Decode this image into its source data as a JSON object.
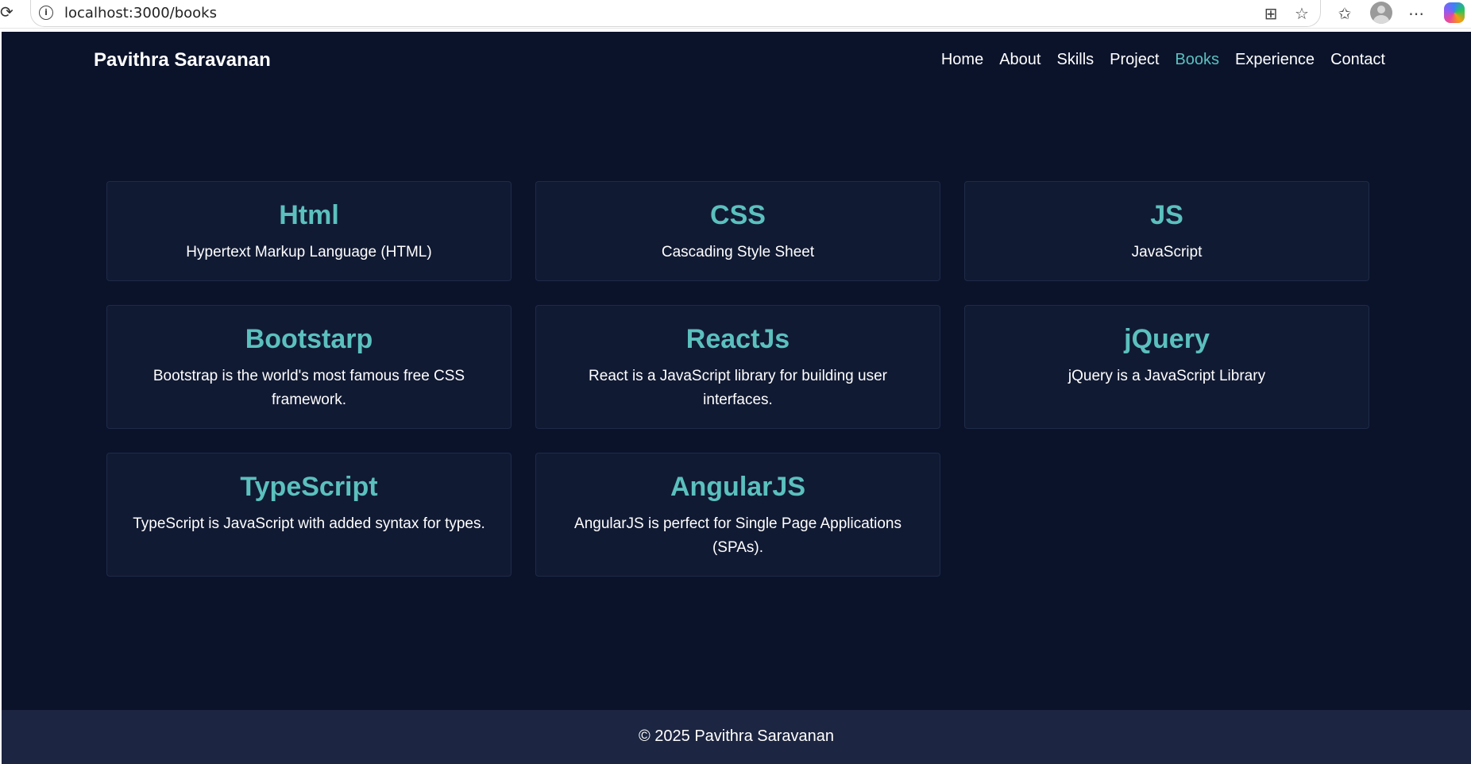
{
  "browser": {
    "url": "localhost:3000/books",
    "reload_icon": "reload-icon",
    "info_icon": "info-icon",
    "icons": [
      "apps-icon",
      "star-icon",
      "favorites-icon",
      "profile-icon",
      "more-icon",
      "copilot-icon"
    ]
  },
  "navbar": {
    "brand": "Pavithra Saravanan",
    "links": [
      "Home",
      "About",
      "Skills",
      "Project",
      "Books",
      "Experience",
      "Contact"
    ],
    "active": "Books"
  },
  "books": [
    {
      "title": "Html",
      "description": "Hypertext Markup Language (HTML)"
    },
    {
      "title": "CSS",
      "description": "Cascading Style Sheet"
    },
    {
      "title": "JS",
      "description": "JavaScript"
    },
    {
      "title": "Bootstarp",
      "description": "Bootstrap is the world's most famous free CSS framework."
    },
    {
      "title": "ReactJs",
      "description": "React is a JavaScript library for building user interfaces."
    },
    {
      "title": "jQuery",
      "description": "jQuery is a JavaScript Library"
    },
    {
      "title": "TypeScript",
      "description": "TypeScript is JavaScript with added syntax for types."
    },
    {
      "title": "AngularJS",
      "description": "AngularJS is perfect for Single Page Applications (SPAs)."
    }
  ],
  "footer": {
    "text": "© 2025 Pavithra Saravanan"
  },
  "colors": {
    "background": "#0b132b",
    "card": "#111a33",
    "accent": "#5bc0be",
    "footer": "#1c2541"
  }
}
